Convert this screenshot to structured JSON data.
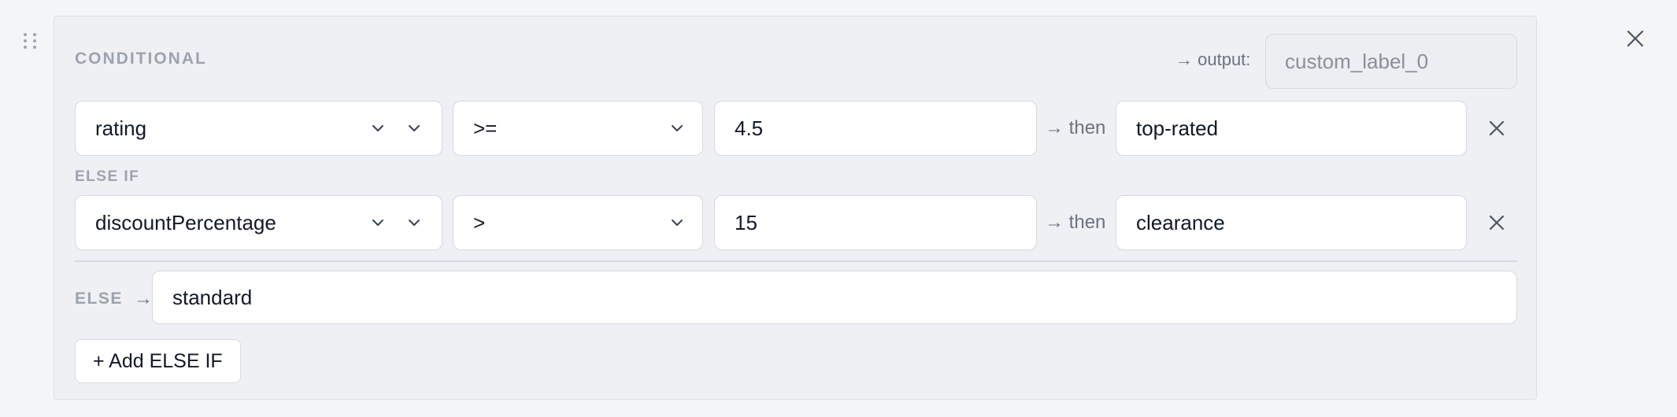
{
  "block": {
    "title": "CONDITIONAL",
    "output_label": "output:",
    "output_value": "custom_label_0"
  },
  "conditions": [
    {
      "field": "rating",
      "operator": ">=",
      "value": "4.5",
      "then_label": "then",
      "result": "top-rated"
    },
    {
      "field": "discountPercentage",
      "operator": ">",
      "value": "15",
      "then_label": "then",
      "result": "clearance"
    }
  ],
  "else_if_label": "ELSE IF",
  "else": {
    "label": "ELSE",
    "value": "standard"
  },
  "add_button_label": "+ Add ELSE IF",
  "icons": {
    "drag": "drag-handle-icon",
    "close": "close-icon",
    "chevron": "chevron-down-icon",
    "arrow": "arrow-right-icon",
    "remove": "remove-icon"
  }
}
